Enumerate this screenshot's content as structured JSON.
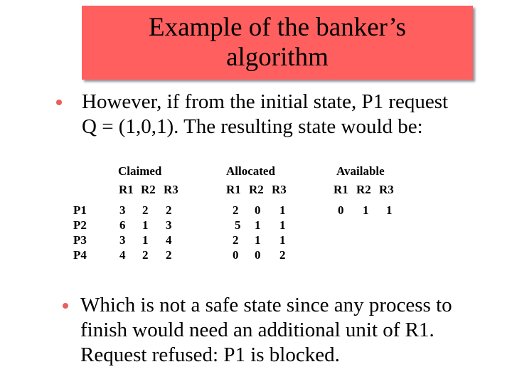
{
  "title": {
    "lines": [
      "Example of the banker’s",
      "algorithm"
    ],
    "background_color": "#ff5f5f"
  },
  "bullets": [
    {
      "icon": "bullet-dot-icon",
      "lines": [
        "However, if from the initial state, P1 request",
        "Q = (1,0,1). The resulting state would be:"
      ]
    },
    {
      "icon": "bullet-dot-icon",
      "lines": [
        "Which is not a safe state since any process to",
        "finish would need an additional unit of R1.",
        "Request refused: P1 is blocked."
      ]
    }
  ],
  "bullet_color": "#e8605e",
  "state_table": {
    "processes": [
      "P1",
      "P2",
      "P3",
      "P4"
    ],
    "resources": [
      "R1",
      "R2",
      "R3"
    ],
    "claimed": {
      "label": "Claimed",
      "rows": [
        [
          3,
          2,
          2
        ],
        [
          6,
          1,
          3
        ],
        [
          3,
          1,
          4
        ],
        [
          4,
          2,
          2
        ]
      ]
    },
    "allocated": {
      "label": "Allocated",
      "rows": [
        [
          2,
          0,
          1
        ],
        [
          5,
          1,
          1
        ],
        [
          2,
          1,
          1
        ],
        [
          0,
          0,
          2
        ]
      ]
    },
    "available": {
      "label": "Available",
      "values": [
        0,
        1,
        1
      ]
    }
  }
}
